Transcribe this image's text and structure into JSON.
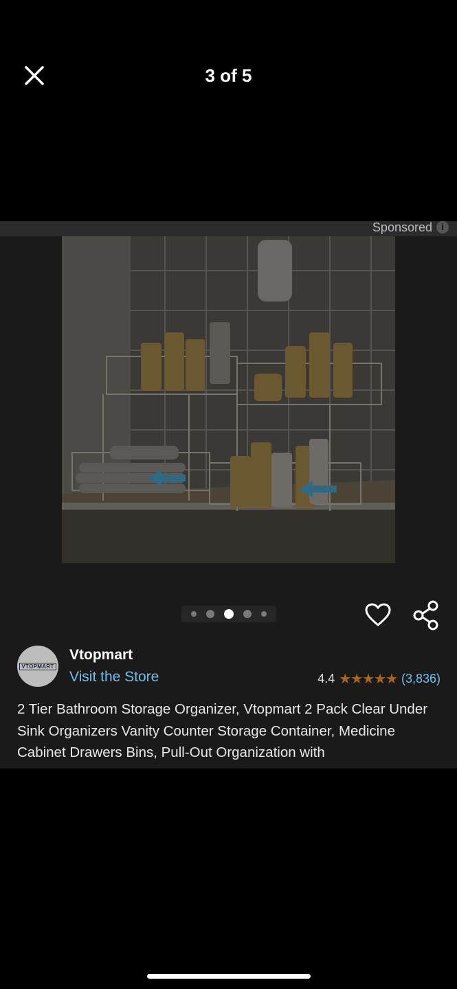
{
  "header": {
    "page_counter": "3 of 5"
  },
  "ad": {
    "sponsored_label": "Sponsored",
    "info_icon_glyph": "i"
  },
  "gallery": {
    "current": 3,
    "total": 5
  },
  "seller": {
    "avatar_text": "VTOPMART",
    "name": "Vtopmart",
    "visit_store": "Visit the Store"
  },
  "rating": {
    "value": "4.4",
    "stars_glyph": "★★★★★",
    "review_count": "(3,836)"
  },
  "product": {
    "title": "2 Tier Bathroom Storage Organizer, Vtopmart 2 Pack Clear Under Sink Organizers Vanity Counter Storage Container, Medicine Cabinet Drawers Bins, Pull-Out Organization with"
  },
  "icons": {
    "close": "close-icon",
    "heart": "heart-icon",
    "share": "share-icon",
    "info": "info-icon"
  },
  "colors": {
    "background": "#000000",
    "card": "#1a1a1a",
    "link": "#6ec0ec",
    "star": "#a8661c"
  }
}
